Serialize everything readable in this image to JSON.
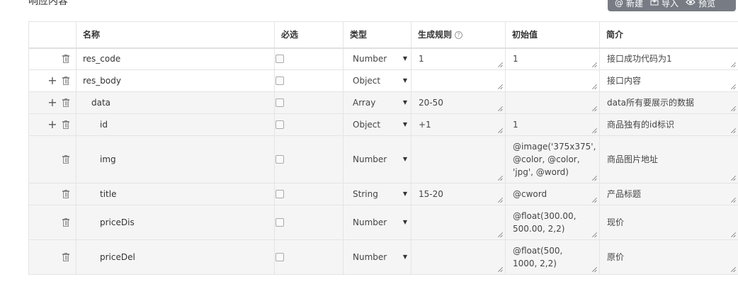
{
  "section": {
    "title": "响应内容"
  },
  "toolbar": {
    "new_label": "新建",
    "new_icon": "at-icon",
    "import_label": "导入",
    "import_icon": "import-icon",
    "preview_label": "预览",
    "preview_icon": "eye-icon"
  },
  "table": {
    "headers": {
      "name": "名称",
      "required": "必选",
      "type": "类型",
      "rule": "生成规则",
      "rule_help": "?",
      "initial": "初始值",
      "desc": "简介"
    },
    "rows": [
      {
        "has_plus": false,
        "name": "res_code",
        "indent": 0,
        "required": false,
        "type": "Number",
        "rule": "1",
        "initial": "1",
        "desc": "接口成功代码为1"
      },
      {
        "has_plus": true,
        "name": "res_body",
        "indent": 0,
        "required": false,
        "type": "Object",
        "rule": "",
        "initial": "",
        "desc": "接口内容"
      },
      {
        "has_plus": true,
        "name": "data",
        "indent": 1,
        "required": false,
        "type": "Array",
        "rule": "20-50",
        "initial": "",
        "desc": "data所有要展示的数据"
      },
      {
        "has_plus": true,
        "name": "id",
        "indent": 2,
        "required": false,
        "type": "Object",
        "rule": "+1",
        "initial": "1",
        "desc": "商品独有的id标识"
      },
      {
        "has_plus": false,
        "name": "img",
        "indent": 2,
        "required": false,
        "type": "Number",
        "rule": "",
        "initial": "@image('375x375', @color, @color, 'jpg', @word)",
        "desc": "商品图片地址"
      },
      {
        "has_plus": false,
        "name": "title",
        "indent": 2,
        "required": false,
        "type": "String",
        "rule": "15-20",
        "initial": "@cword",
        "desc": "产品标题"
      },
      {
        "has_plus": false,
        "name": "priceDis",
        "indent": 2,
        "required": false,
        "type": "Number",
        "rule": "",
        "initial": "@float(300.00, 500.00, 2,2)",
        "desc": "现价"
      },
      {
        "has_plus": false,
        "name": "priceDel",
        "indent": 2,
        "required": false,
        "type": "Number",
        "rule": "",
        "initial": "@float(500, 1000, 2,2)",
        "desc": "原价"
      }
    ]
  }
}
